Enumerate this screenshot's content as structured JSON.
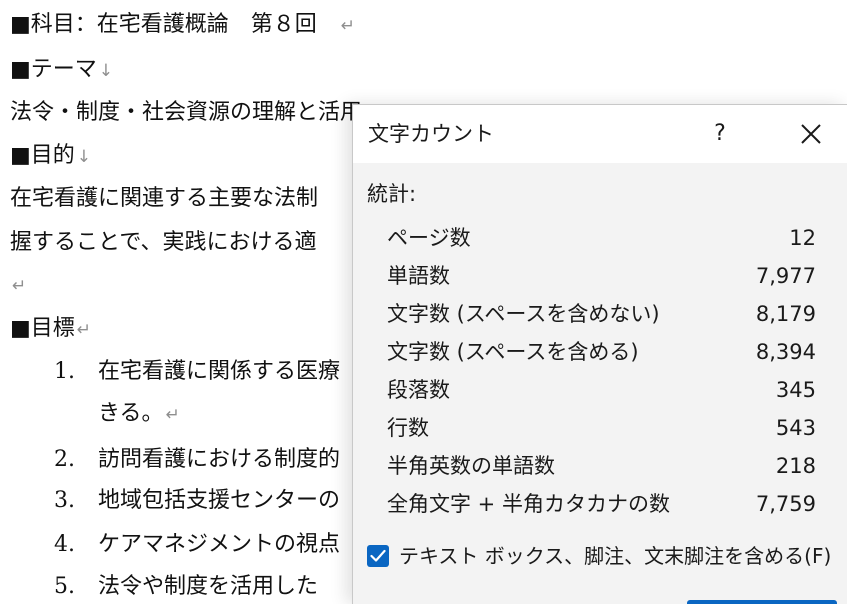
{
  "document": {
    "heading_subject": "■科目：在宅看護概論　第８回",
    "heading_theme": "■テーマ",
    "theme_text": "法令・制度・社会資源の理解と活用",
    "heading_purpose": "■目的",
    "purpose_line1": "在宅看護に関連する主要な法制",
    "purpose_line2": "握することで、実践における適",
    "heading_goals": "■目標",
    "paragraph_mark": "↵",
    "down_arrow": "↓",
    "goals": [
      {
        "num": "1.",
        "text": "在宅看護に関係する医療",
        "continuation": "きる。"
      },
      {
        "num": "2.",
        "text": "訪問看護における制度的"
      },
      {
        "num": "3.",
        "text": "地域包括支援センターの"
      },
      {
        "num": "4.",
        "text": "ケアマネジメントの視点"
      },
      {
        "num": "5.",
        "text": "法令や制度を活用した"
      }
    ]
  },
  "dialog": {
    "title": "文字カウント",
    "help_label": "?",
    "close_icon": "close-icon",
    "stats_label": "統計:",
    "stats": [
      {
        "name": "ページ数",
        "value": "12"
      },
      {
        "name": "単語数",
        "value": "7,977"
      },
      {
        "name": "文字数 (スペースを含めない)",
        "value": "8,179"
      },
      {
        "name": "文字数 (スペースを含める)",
        "value": "8,394"
      },
      {
        "name": "段落数",
        "value": "345"
      },
      {
        "name": "行数",
        "value": "543"
      },
      {
        "name": "半角英数の単語数",
        "value": "218"
      },
      {
        "name": "全角文字 + 半角カタカナの数",
        "value": "7,759"
      }
    ],
    "checkbox_label": "テキスト ボックス、脚注、文末脚注を含める(F)",
    "checkbox_checked": true,
    "accent_color": "#0a66c2"
  }
}
